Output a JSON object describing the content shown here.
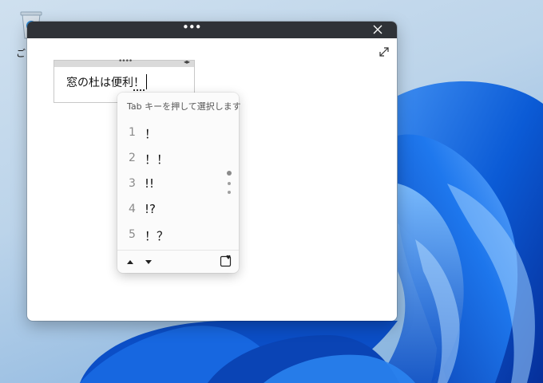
{
  "desktop": {
    "recycle_bin_label": "ご"
  },
  "window": {
    "menu_dots": "•••",
    "close_icon": "close-icon",
    "expand_icon": "expand-icon"
  },
  "editor": {
    "grip": "••••",
    "resize_arrows": "◂▸",
    "text_committed": "窓の杜は便利",
    "text_composing": "！"
  },
  "ime": {
    "hint": "Tab キーを押して選択します",
    "candidates": [
      {
        "num": "1",
        "value": "！"
      },
      {
        "num": "2",
        "value": "！！"
      },
      {
        "num": "3",
        "value": "!!"
      },
      {
        "num": "4",
        "value": "!?"
      },
      {
        "num": "5",
        "value": "！？"
      }
    ],
    "footer_icons": [
      "up-arrow-icon",
      "down-arrow-icon",
      "favorite-icon"
    ]
  },
  "colors": {
    "titlebar": "#2f3237",
    "wallpaper_blue": "#0a5bd8"
  }
}
